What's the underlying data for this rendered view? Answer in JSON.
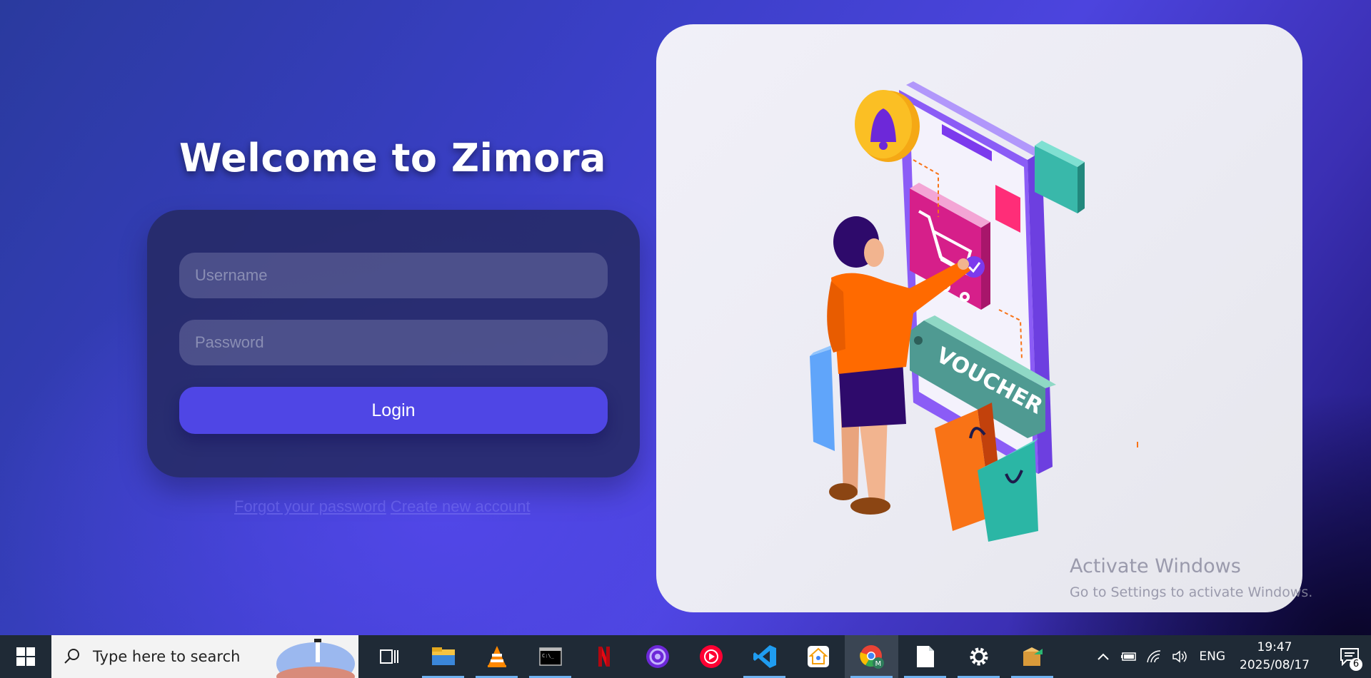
{
  "page": {
    "title": "Welcome to Zimora"
  },
  "login": {
    "username_placeholder": "Username",
    "password_placeholder": "Password",
    "login_label": "Login",
    "forgot_password_link": "Forgot your password",
    "other_link": "Create new account"
  },
  "illustration": {
    "voucher_text": "VOUCHER",
    "icons": [
      "bell-icon",
      "shopping-cart-icon",
      "check-icon",
      "shopping-bag-icon"
    ]
  },
  "watermark": {
    "line1": "Activate Windows",
    "line2": "Go to Settings to activate Windows."
  },
  "taskbar": {
    "search_placeholder": "Type here to search",
    "apps": [
      {
        "name": "task-view-icon"
      },
      {
        "name": "file-explorer-icon"
      },
      {
        "name": "vlc-icon"
      },
      {
        "name": "terminal-icon"
      },
      {
        "name": "netflix-icon"
      },
      {
        "name": "audio-app-icon"
      },
      {
        "name": "youtube-music-icon"
      },
      {
        "name": "vscode-icon"
      },
      {
        "name": "home-app-icon"
      },
      {
        "name": "chrome-icon"
      },
      {
        "name": "notepad-icon"
      },
      {
        "name": "settings-icon"
      },
      {
        "name": "package-icon"
      }
    ],
    "tray": {
      "language": "ENG",
      "time": "19:47",
      "date": "2025/08/17",
      "notification_count": "6"
    }
  },
  "colors": {
    "accent": "#4f46e5",
    "card_bg": "#262a64",
    "taskbar_bg": "#1f2a36"
  }
}
